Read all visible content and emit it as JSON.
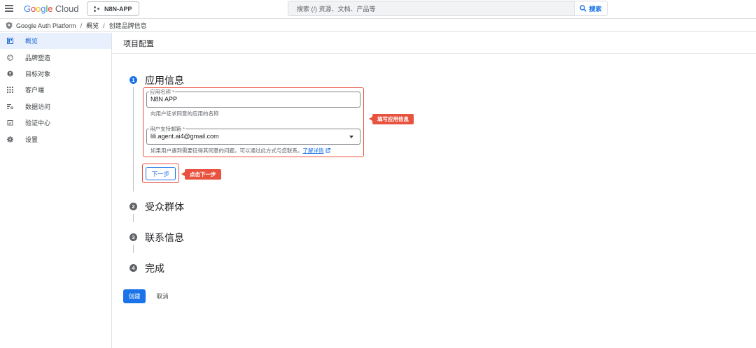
{
  "header": {
    "logo_google": [
      "G",
      "o",
      "o",
      "g",
      "l",
      "e"
    ],
    "logo_cloud": "Cloud",
    "project": "N8N-APP",
    "search_placeholder": "搜索 (/) 资源、文档、产品等",
    "search_button": "搜索"
  },
  "breadcrumb": {
    "items": [
      "Google Auth Platform",
      "概览",
      "创建品牌信息"
    ]
  },
  "sidebar": {
    "items": [
      {
        "label": "概览",
        "icon": "dashboard-icon",
        "active": true
      },
      {
        "label": "品牌塑造",
        "icon": "palette-icon",
        "active": false
      },
      {
        "label": "目标对象",
        "icon": "person-icon",
        "active": false
      },
      {
        "label": "客户端",
        "icon": "apps-grid-icon",
        "active": false
      },
      {
        "label": "数据访问",
        "icon": "data-access-icon",
        "active": false
      },
      {
        "label": "验证中心",
        "icon": "verification-icon",
        "active": false
      },
      {
        "label": "设置",
        "icon": "gear-icon",
        "active": false
      }
    ]
  },
  "main": {
    "title": "项目配置",
    "steps": [
      {
        "number": "1",
        "label": "应用信息",
        "active": true
      },
      {
        "number": "2",
        "label": "受众群体",
        "active": false
      },
      {
        "number": "3",
        "label": "联系信息",
        "active": false
      },
      {
        "number": "4",
        "label": "完成",
        "active": false
      }
    ],
    "app_name": {
      "label": "应用名称 *",
      "value": "N8N APP",
      "hint": "向用户征求同意的应用的名称"
    },
    "support_email": {
      "label": "用户支持邮箱 *",
      "value": "lili.agent.ai4@gmail.com",
      "hint": "如果用户遇到需要征得其同意的问题，可以通过此方式与您联系。",
      "hint_link": "了解详情"
    },
    "next_button": "下一步",
    "create_button": "创建",
    "cancel_button": "取消"
  },
  "annotations": {
    "fill_app_info": "填写应用信息",
    "click_next": "点击下一步"
  },
  "colors": {
    "accent": "#1a73e8",
    "callout": "#e8533f",
    "active_nav_bg": "#e8f0fe"
  }
}
